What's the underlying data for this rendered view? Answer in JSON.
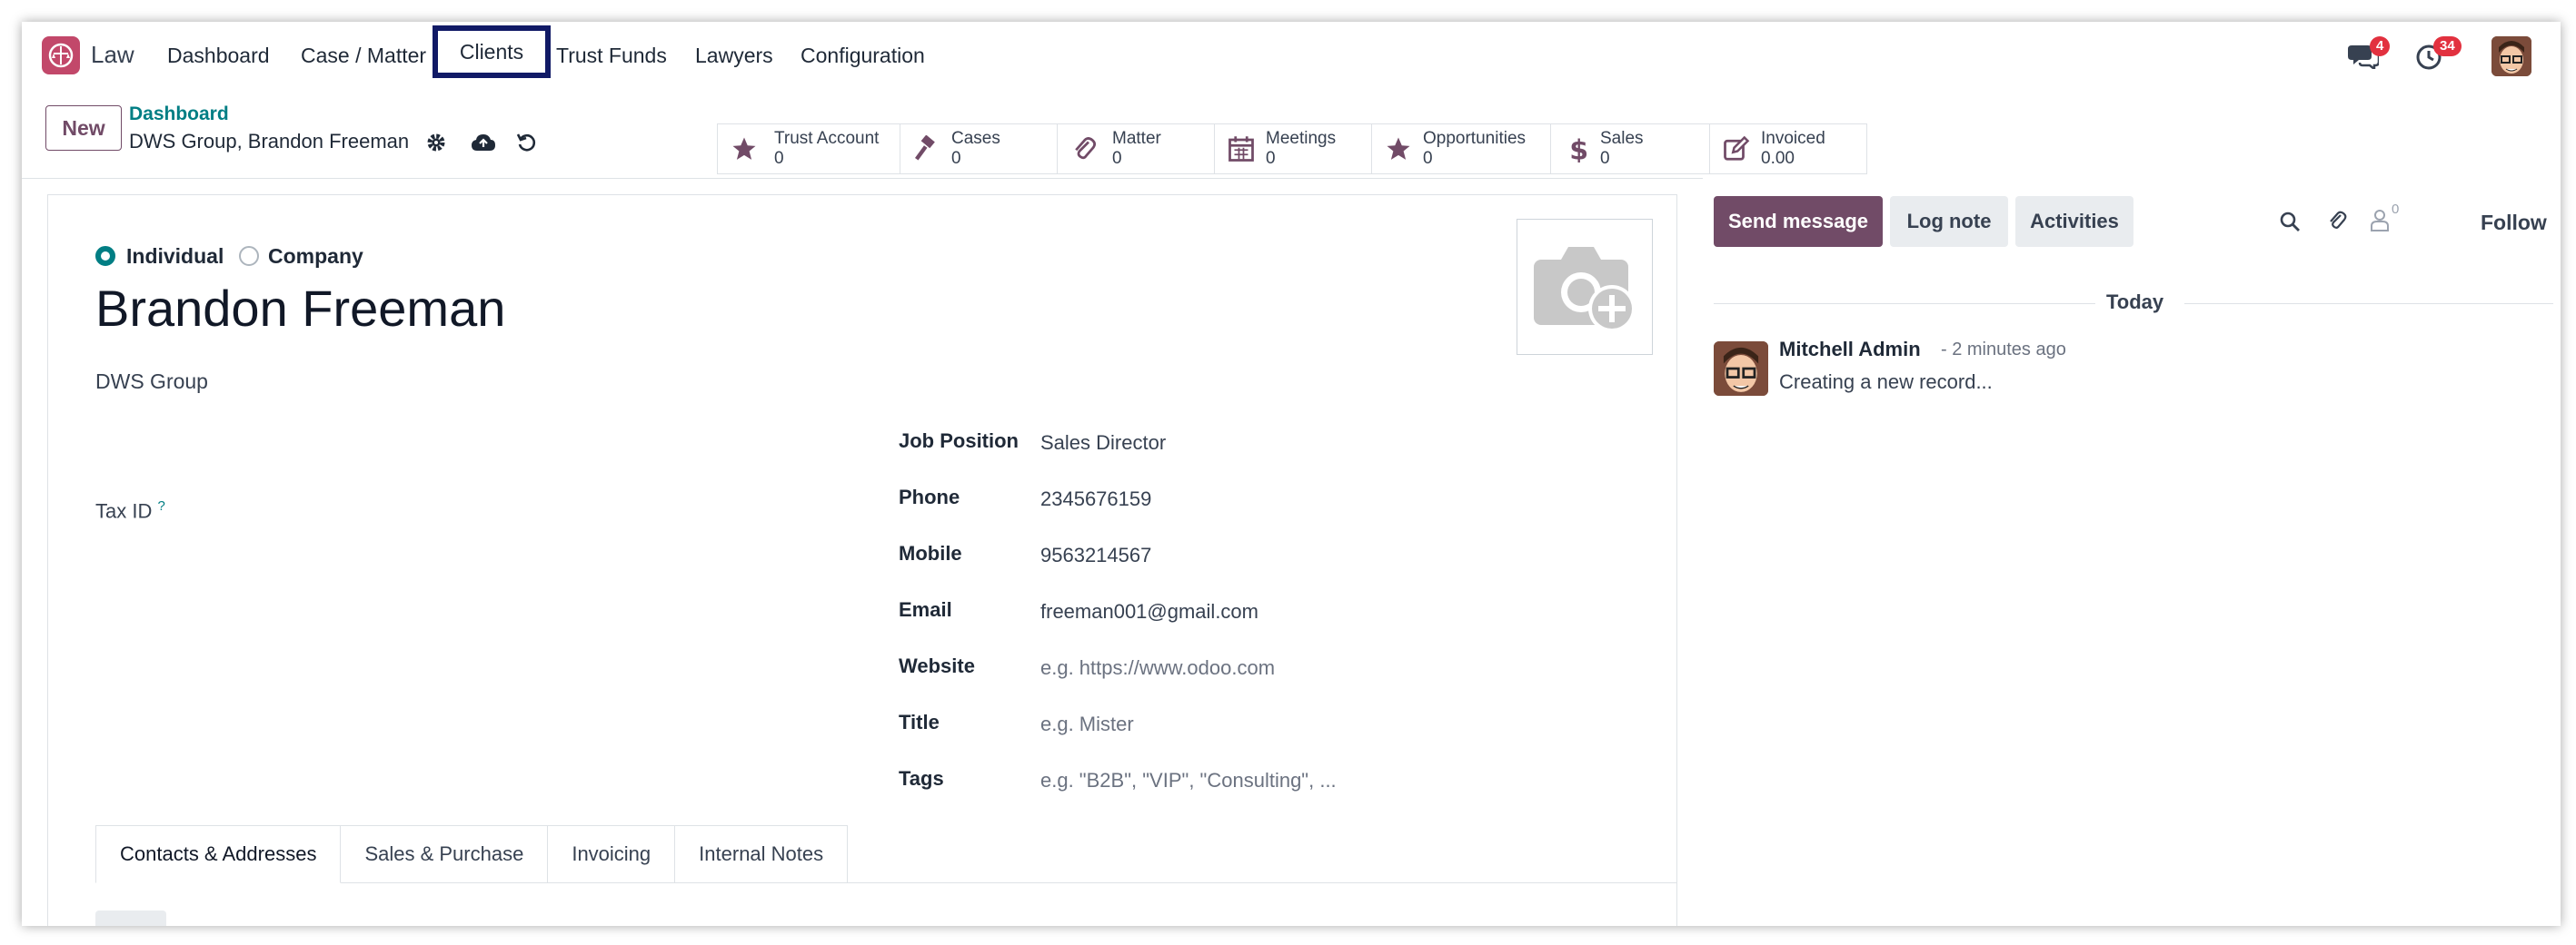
{
  "navbar": {
    "app_name": "Law",
    "menu": [
      "Dashboard",
      "Case / Matter",
      "Clients",
      "Trust Funds",
      "Lawyers",
      "Configuration"
    ],
    "messages_count": "4",
    "activities_count": "34"
  },
  "control_panel": {
    "new_label": "New",
    "breadcrumb_parent": "Dashboard",
    "breadcrumb_current": "DWS Group, Brandon Freeman",
    "stats": [
      {
        "label": "Trust Account",
        "value": "0",
        "icon": "star-icon"
      },
      {
        "label": "Cases",
        "value": "0",
        "icon": "gavel-icon"
      },
      {
        "label": "Matter",
        "value": "0",
        "icon": "paperclip-icon"
      },
      {
        "label": "Meetings",
        "value": "0",
        "icon": "calendar-icon"
      },
      {
        "label": "Opportunities",
        "value": "0",
        "icon": "star-icon"
      },
      {
        "label": "Sales",
        "value": "0",
        "icon": "dollar-icon"
      },
      {
        "label": "Invoiced",
        "value": "0.00",
        "icon": "edit-icon"
      }
    ]
  },
  "form": {
    "type_individual": "Individual",
    "type_company": "Company",
    "name": "Brandon Freeman",
    "company": "DWS Group",
    "tax_id_label": "Tax ID",
    "tax_id_help": "?",
    "fields": [
      {
        "label": "Job Position",
        "value": "Sales Director",
        "placeholder": false
      },
      {
        "label": "Phone",
        "value": "2345676159",
        "placeholder": false
      },
      {
        "label": "Mobile",
        "value": "9563214567",
        "placeholder": false
      },
      {
        "label": "Email",
        "value": "freeman001@gmail.com",
        "placeholder": false
      },
      {
        "label": "Website",
        "value": "e.g. https://www.odoo.com",
        "placeholder": true
      },
      {
        "label": "Title",
        "value": "e.g. Mister",
        "placeholder": true
      },
      {
        "label": "Tags",
        "value": "e.g. \"B2B\", \"VIP\", \"Consulting\", ...",
        "placeholder": true
      }
    ],
    "tabs": [
      "Contacts & Addresses",
      "Sales & Purchase",
      "Invoicing",
      "Internal Notes"
    ]
  },
  "chatter": {
    "send_message": "Send message",
    "log_note": "Log note",
    "activities": "Activities",
    "followers_count": "0",
    "follow": "Follow",
    "today": "Today",
    "message": {
      "author": "Mitchell Admin",
      "time": "- 2 minutes ago",
      "body": "Creating a new record..."
    }
  },
  "colors": {
    "brand": "#714b67",
    "teal": "#017e84",
    "badge": "#e2313f",
    "highlight_box": "#111a66"
  }
}
